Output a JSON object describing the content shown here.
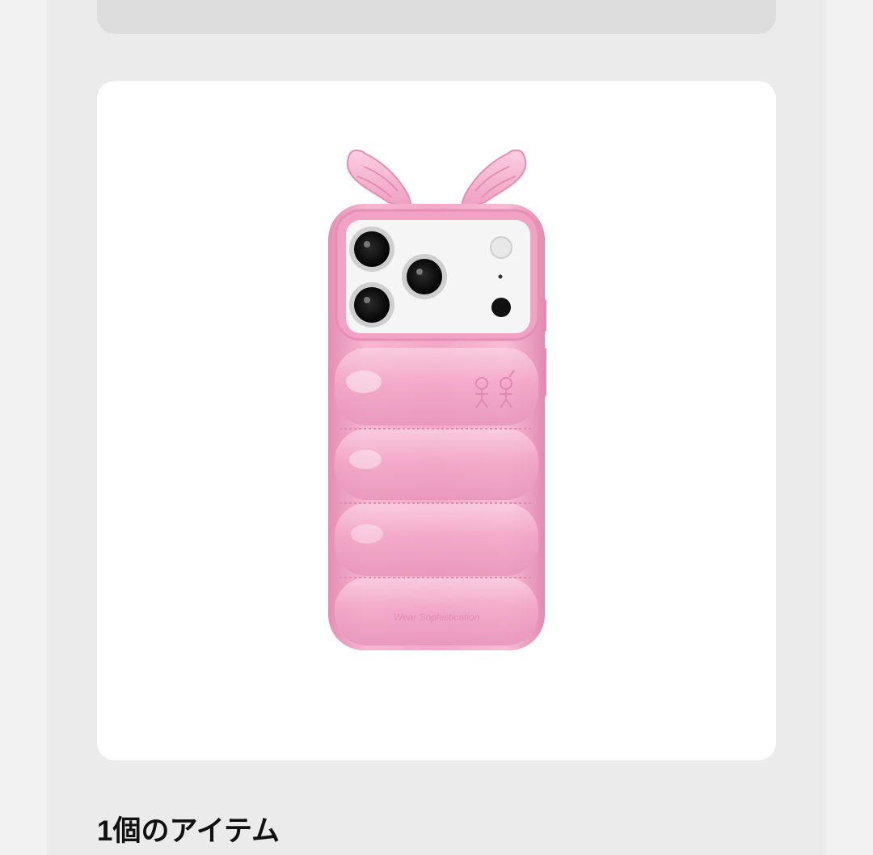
{
  "colors": {
    "page_background": "#ebebeb",
    "card_background": "#ffffff",
    "case_pink": "#f4a9c8"
  },
  "product_image": {
    "icon": "pink-phone-case-with-wings-image",
    "embossed_text": "Wear Sophistication"
  },
  "items_section": {
    "heading": "1個のアイテム"
  }
}
